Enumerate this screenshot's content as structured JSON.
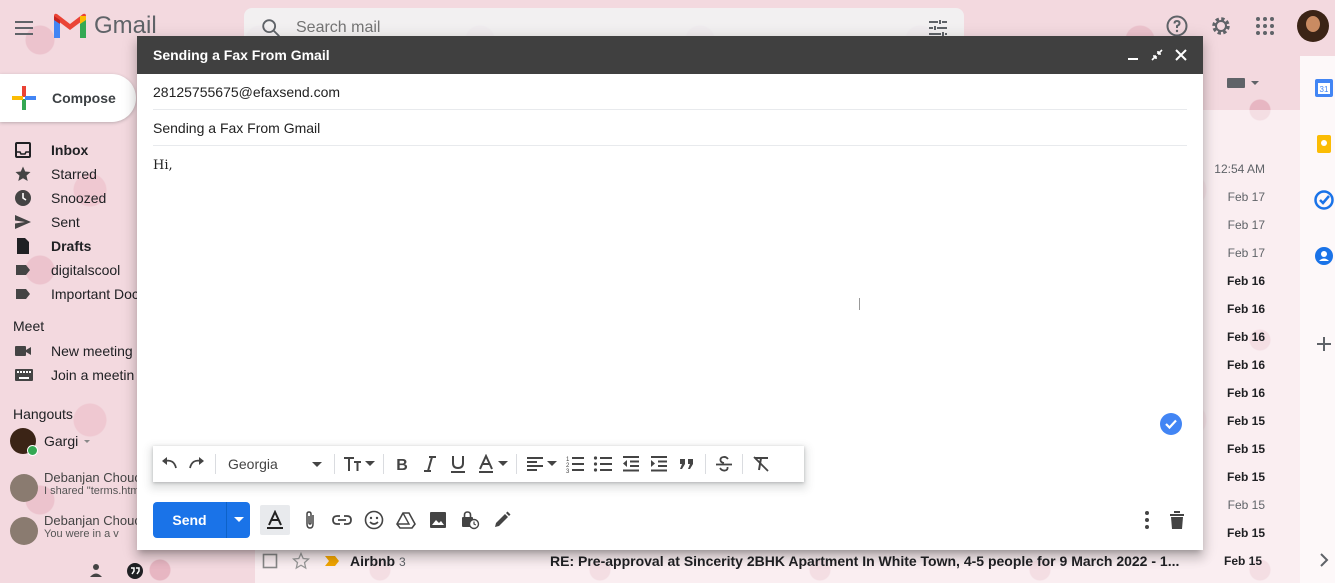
{
  "app": {
    "name": "Gmail"
  },
  "search": {
    "placeholder": "Search mail"
  },
  "sidebar": {
    "compose_label": "Compose",
    "items": [
      {
        "label": "Inbox",
        "icon": "inbox-icon",
        "bold": true
      },
      {
        "label": "Starred",
        "icon": "star-icon"
      },
      {
        "label": "Snoozed",
        "icon": "clock-icon"
      },
      {
        "label": "Sent",
        "icon": "send-icon"
      },
      {
        "label": "Drafts",
        "icon": "draft-icon",
        "bold": true
      },
      {
        "label": "digitalscool",
        "icon": "label-icon"
      },
      {
        "label": "Important Doc",
        "icon": "label-icon"
      }
    ],
    "meet_title": "Meet",
    "meet_items": [
      "New meeting",
      "Join a meetin"
    ],
    "hangouts_title": "Hangouts",
    "hangouts_user": "Gargi",
    "chats": [
      {
        "name": "Debanjan Chouc",
        "message": "I shared \"terms.htm"
      },
      {
        "name": "Debanjan Chouc",
        "message": "You were in a v"
      }
    ]
  },
  "mail_list": {
    "dates": [
      {
        "text": "12:54 AM",
        "bold": false
      },
      {
        "text": "Feb 17",
        "bold": false
      },
      {
        "text": "Feb 17",
        "bold": false
      },
      {
        "text": "Feb 17",
        "bold": false
      },
      {
        "text": "Feb 16",
        "bold": true
      },
      {
        "text": "Feb 16",
        "bold": true
      },
      {
        "text": "Feb 16",
        "bold": true
      },
      {
        "text": "Feb 16",
        "bold": true
      },
      {
        "text": "Feb 16",
        "bold": true
      },
      {
        "text": "Feb 15",
        "bold": true
      },
      {
        "text": "Feb 15",
        "bold": true
      },
      {
        "text": "Feb 15",
        "bold": true
      },
      {
        "text": "Feb 15",
        "bold": false
      },
      {
        "text": "Feb 15",
        "bold": true
      }
    ],
    "bottom_row": {
      "sender": "Airbnb",
      "count": "3",
      "subject": "RE: Pre-approval at Sincerity 2BHK Apartment In White Town, 4-5 people for 9 March 2022 - 1...",
      "date": "Feb 15"
    }
  },
  "compose_window": {
    "title": "Sending a Fax From Gmail",
    "to": "28125755675@efaxsend.com",
    "subject": "Sending a Fax From Gmail",
    "body": "Hi,",
    "font": "Georgia",
    "send_label": "Send"
  },
  "colors": {
    "send_button": "#1a73e8",
    "header_bar": "#404040",
    "check_badge": "#4285f4"
  }
}
